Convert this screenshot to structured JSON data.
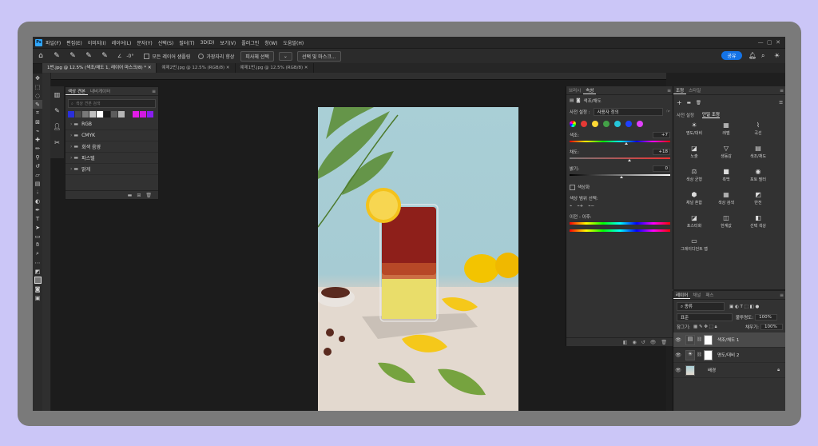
{
  "menubar": {
    "logo": "Ps",
    "items": [
      "파일(F)",
      "편집(E)",
      "이미지(I)",
      "레이어(L)",
      "문자(Y)",
      "선택(S)",
      "필터(T)",
      "3D(D)",
      "보기(V)",
      "플러그인",
      "창(W)",
      "도움말(H)"
    ]
  },
  "options": {
    "angle": "-0°",
    "sample_all_layers": "모든 레이어 샘플링",
    "edge_toggle": "가장자리 향상",
    "subject_select": "피사체 선택",
    "select_mask": "선택 및 마스크...",
    "share": "공유"
  },
  "tabs": [
    {
      "label": "1번.jpg @ 12.5% (색조/채도 1, 레이어 마스크/8) *",
      "active": true
    },
    {
      "label": "예제2번.jpg @ 12.5% (RGB/8)",
      "active": false
    },
    {
      "label": "예제1번.jpg @ 12.5% (RGB/8)",
      "active": false
    }
  ],
  "swatches_panel": {
    "tabs": [
      "색상 견본",
      "내비게이터"
    ],
    "search_placeholder": "색상 견본 검색",
    "recent_colors": [
      "#2a2fdc",
      "#4a4a4a",
      "#7a7a7a",
      "#c0c0c0",
      "#ffffff",
      "#1a1a1a",
      "#5c5c5c",
      "#b6b6b6",
      "#333333",
      "#e21ce8",
      "#d11ae0",
      "#8a1ef0"
    ],
    "folders": [
      "RGB",
      "CMYK",
      "회색 음영",
      "파스텔",
      "밝게"
    ]
  },
  "properties": {
    "tabs": [
      "브러시",
      "속성"
    ],
    "title": "색조/채도",
    "preset_label": "사전 설정 :",
    "preset_value": "사용자 정의",
    "colors": [
      "#e53935",
      "#fdd835",
      "#43a047",
      "#26c6da",
      "#1e40ff",
      "#e040fb"
    ],
    "hue_label": "색조:",
    "hue_value": "+7",
    "sat_label": "채도:",
    "sat_value": "+18",
    "light_label": "밝기:",
    "light_value": "0",
    "colorize_label": "색상화",
    "range_label": "색상 범위 선택:",
    "before_after_label": "이전 - 이후:"
  },
  "adjustments": {
    "tabs": [
      "조정",
      "스타일"
    ],
    "subtabs": [
      "사전 설정",
      "단일 조정"
    ],
    "items": [
      {
        "icon": "☀",
        "label": "명도/대비"
      },
      {
        "icon": "▦",
        "label": "레벨"
      },
      {
        "icon": "⌇",
        "label": "곡선"
      },
      {
        "icon": "◪",
        "label": "노출"
      },
      {
        "icon": "▽",
        "label": "생동감"
      },
      {
        "icon": "▤",
        "label": "색조/채도"
      },
      {
        "icon": "⚖",
        "label": "색상 균형"
      },
      {
        "icon": "■",
        "label": "흑백"
      },
      {
        "icon": "◉",
        "label": "포토 필터"
      },
      {
        "icon": "⬢",
        "label": "채널 혼합"
      },
      {
        "icon": "▦",
        "label": "색상 검색"
      },
      {
        "icon": "◩",
        "label": "반전"
      },
      {
        "icon": "◪",
        "label": "포스터화"
      },
      {
        "icon": "◫",
        "label": "한계값"
      },
      {
        "icon": "◧",
        "label": "선택 색상"
      },
      {
        "icon": "▭",
        "label": "그레이디언트 맵"
      }
    ]
  },
  "layers_panel": {
    "tabs": [
      "레이어",
      "채널",
      "패스"
    ],
    "filter": "종류",
    "blend_mode": "표준",
    "opacity_label": "불투명도:",
    "opacity": "100%",
    "lock_label": "잠그기:",
    "fill_label": "채우기:",
    "fill": "100%",
    "layers": [
      {
        "name": "색조/채도 1",
        "icon": "▤",
        "selected": true
      },
      {
        "name": "명도/대비 2",
        "icon": "☀",
        "selected": false
      },
      {
        "name": "배경",
        "icon": "",
        "selected": false
      }
    ]
  }
}
